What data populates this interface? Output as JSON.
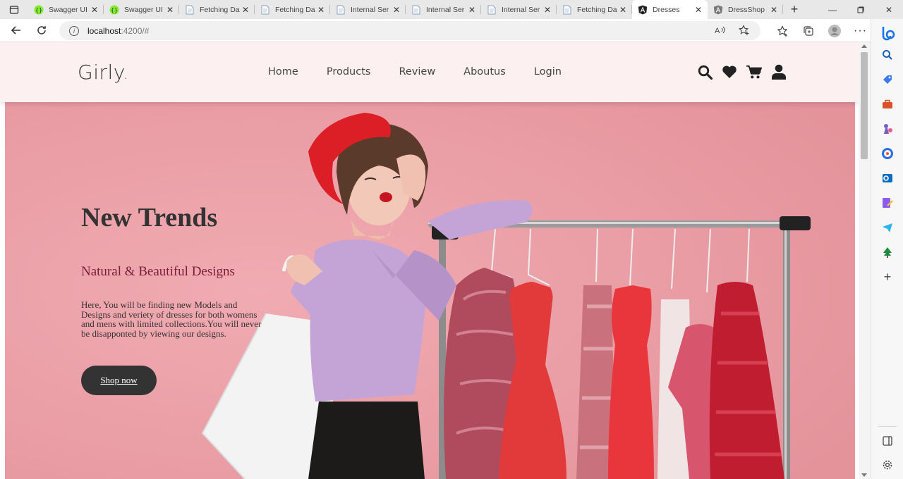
{
  "browser": {
    "tabs": [
      {
        "label": "Swagger UI",
        "icon": "swagger-icon",
        "active": false
      },
      {
        "label": "Swagger UI",
        "icon": "swagger-icon",
        "active": false
      },
      {
        "label": "Fetching Da",
        "icon": "page-icon",
        "active": false
      },
      {
        "label": "Fetching Da",
        "icon": "page-icon",
        "active": false
      },
      {
        "label": "Internal Ser",
        "icon": "page-icon",
        "active": false
      },
      {
        "label": "Internal Ser",
        "icon": "page-icon",
        "active": false
      },
      {
        "label": "Internal Ser",
        "icon": "page-icon",
        "active": false
      },
      {
        "label": "Fetching Da",
        "icon": "page-icon",
        "active": false
      },
      {
        "label": "Dresses",
        "icon": "angular-icon",
        "active": true
      },
      {
        "label": "DressShop",
        "icon": "angular-grey-icon",
        "active": false
      }
    ],
    "address": {
      "host": "localhost",
      "path": ":4200/#"
    }
  },
  "site": {
    "logo_text": "Girly",
    "logo_dot": ".",
    "nav": [
      "Home",
      "Products",
      "Review",
      "Aboutus",
      "Login"
    ],
    "header_icons": [
      "search-icon",
      "heart-icon",
      "cart-icon",
      "user-icon"
    ]
  },
  "hero": {
    "title": "New Trends",
    "subtitle": "Natural & Beautiful Designs",
    "description": "Here, You will be finding new Models and Designs and veriety of dresses for both womens and mens with limited collections.You will never be disapponted by viewing our designs.",
    "button_label": "Shop now"
  },
  "colors": {
    "hero_bg": "#eca1a8",
    "header_bg": "#fdf0f0",
    "accent": "#e84393",
    "subtitle": "#7a1f3a",
    "button": "#333333"
  }
}
